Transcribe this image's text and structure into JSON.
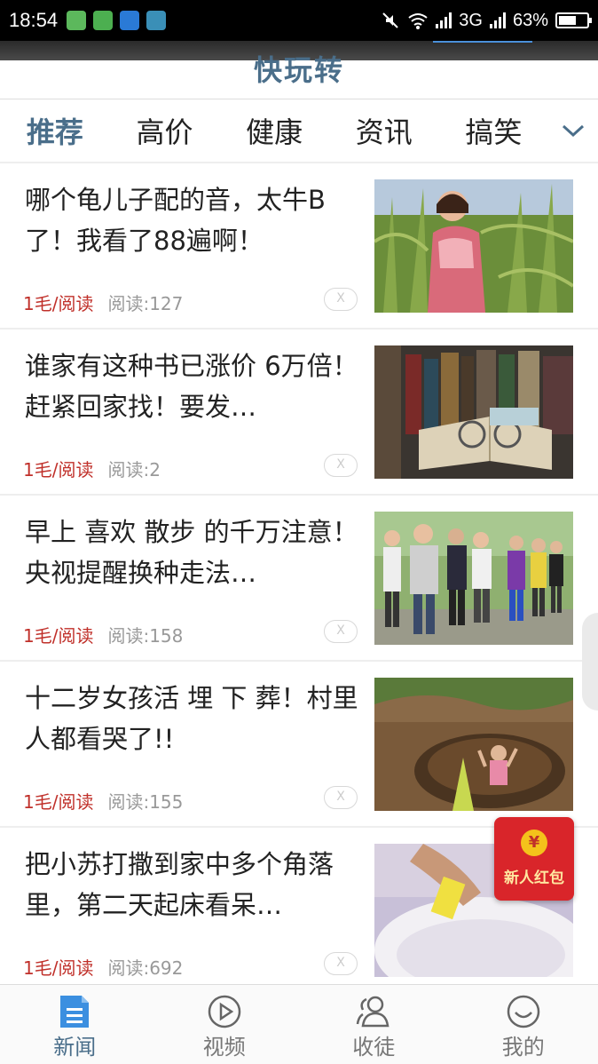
{
  "status_bar": {
    "time": "18:54",
    "network": "3G",
    "battery": "63%",
    "battery_level": 0.63
  },
  "app": {
    "title": "快玩转"
  },
  "tabs": [
    {
      "label": "推荐",
      "active": true
    },
    {
      "label": "高价",
      "active": false
    },
    {
      "label": "健康",
      "active": false
    },
    {
      "label": "资讯",
      "active": false
    },
    {
      "label": "搞笑",
      "active": false
    }
  ],
  "news": [
    {
      "title": "哪个龟儿子配的音，太牛B了！我看了88遍啊！",
      "reward": "1毛/阅读",
      "reads": "阅读:127",
      "dismiss": "X"
    },
    {
      "title": "谁家有这种书已涨价 6万倍！赶紧回家找！要发…",
      "reward": "1毛/阅读",
      "reads": "阅读:2",
      "dismiss": "X"
    },
    {
      "title": "早上 喜欢 散步 的千万注意！央视提醒换种走法…",
      "reward": "1毛/阅读",
      "reads": "阅读:158",
      "dismiss": "X"
    },
    {
      "title": "十二岁女孩活 埋 下 葬！村里人都看哭了!!",
      "reward": "1毛/阅读",
      "reads": "阅读:155",
      "dismiss": "X"
    },
    {
      "title": "把小苏打撒到家中多个角落里，第二天起床看呆…",
      "reward": "1毛/阅读",
      "reads": "阅读:692",
      "dismiss": "X"
    }
  ],
  "red_packet": {
    "coin": "¥",
    "label": "新人红包"
  },
  "bottom_nav": [
    {
      "label": "新闻",
      "icon": "news-doc-icon",
      "active": true
    },
    {
      "label": "视频",
      "icon": "play-circle-icon",
      "active": false
    },
    {
      "label": "收徒",
      "icon": "people-icon",
      "active": false
    },
    {
      "label": "我的",
      "icon": "smile-face-icon",
      "active": false
    }
  ],
  "colors": {
    "accent": "#4a6e8a",
    "reward": "#c0302a",
    "red_packet": "#d9252a",
    "nav_active": "#3b8fe0"
  }
}
